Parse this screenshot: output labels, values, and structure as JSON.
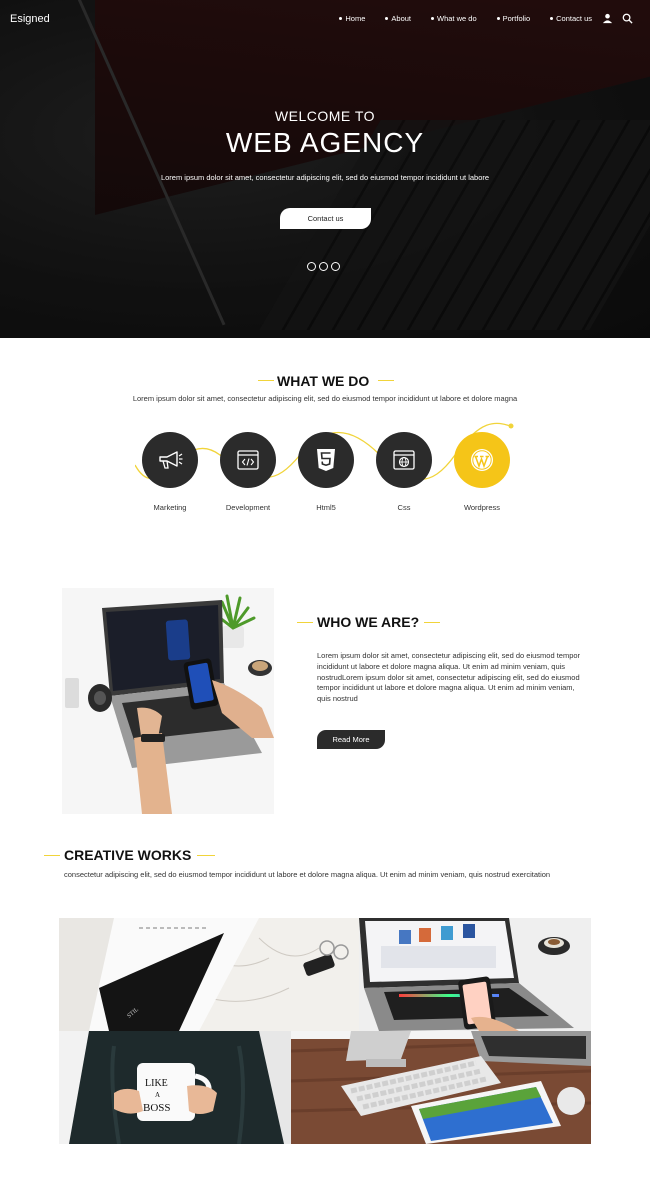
{
  "nav": {
    "brand": "Esigned",
    "items": [
      "Home",
      "About",
      "What we do",
      "Portfolio",
      "Contact us"
    ],
    "icons": [
      "user-icon",
      "search-icon"
    ]
  },
  "hero": {
    "subtitle": "WELCOME TO",
    "title": "WEB AGENCY",
    "text": "Lorem ipsum dolor sit amet, consectetur adipiscing elit, sed do eiusmod tempor incididunt ut labore",
    "button": "Contact us",
    "slides": 3
  },
  "what_we_do": {
    "title": "WHAT WE DO",
    "text": "Lorem ipsum dolor sit amet, consectetur adipiscing elit, sed do eiusmod tempor incididunt ut labore et dolore magna",
    "services": [
      {
        "label": "Marketing",
        "icon": "megaphone-icon"
      },
      {
        "label": "Development",
        "icon": "code-window-icon"
      },
      {
        "label": "Html5",
        "icon": "html5-icon"
      },
      {
        "label": "Css",
        "icon": "globe-window-icon"
      },
      {
        "label": "Wordpress",
        "icon": "wordpress-icon"
      }
    ]
  },
  "who_we_are": {
    "title": "WHO WE ARE?",
    "text": "Lorem ipsum dolor sit amet, consectetur adipiscing elit, sed do eiusmod tempor incididunt ut labore et dolore magna aliqua. Ut enim ad minim veniam, quis nostrudLorem ipsum dolor sit amet, consectetur adipiscing elit, sed do eiusmod tempor incididunt ut labore et dolore magna aliqua. Ut enim ad minim veniam, quis nostrud",
    "button": "Read More"
  },
  "creative_works": {
    "title": "CREATIVE WORKS",
    "text": "consectetur adipiscing elit, sed do eiusmod tempor incididunt ut labore et dolore magna aliqua. Ut enim ad minim veniam, quis nostrud exercitation",
    "mug_text": "LIKE A BOSS"
  },
  "colors": {
    "accent": "#f1d43a",
    "yellow": "#f5c518",
    "dark": "#2b2b2b",
    "hero_bg": "#121212"
  }
}
